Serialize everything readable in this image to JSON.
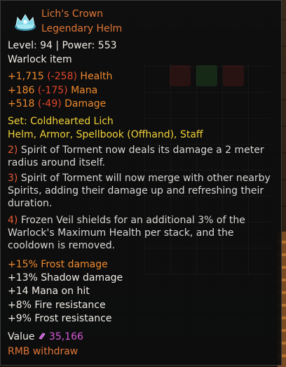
{
  "item": {
    "name": "Lich's Crown",
    "rarity_type": "Legendary Helm",
    "level_power": "Level: 94 | Power: 553",
    "class_line": "Warlock item",
    "icon": "crown-icon",
    "icon_color": "#7fd8e8"
  },
  "base_stats": [
    {
      "value": "+1,715",
      "diff": "(-258)",
      "label": "Health"
    },
    {
      "value": "+186",
      "diff": "(-175)",
      "label": "Mana"
    },
    {
      "value": "+518",
      "diff": "(-49)",
      "label": "Damage"
    }
  ],
  "set": {
    "title": "Set: Coldhearted Lich",
    "pieces": "Helm, Armor, Spellbook (Offhand), Staff",
    "bonuses": [
      {
        "num": "2)",
        "text": "Spirit of Torment now deals its damage a 2 meter radius around itself."
      },
      {
        "num": "3)",
        "text": "Spirit of Torment will now merge with other nearby Spirits, adding their damage up and refreshing their duration."
      },
      {
        "num": "4)",
        "text": "Frozen Veil shields for an additional 3% of the Warlock's Maximum Health per stack, and the cooldown is removed."
      }
    ]
  },
  "affixes": [
    {
      "text": "+15% Frost damage",
      "color": "#f08a2e"
    },
    {
      "text": "+13% Shadow damage",
      "color": "#f0ece6"
    },
    {
      "text": "+14 Mana on hit",
      "color": "#f0ece6"
    },
    {
      "text": "+8% Fire resistance",
      "color": "#f0ece6"
    },
    {
      "text": "+9% Frost resistance",
      "color": "#f0ece6"
    }
  ],
  "value": {
    "label": "Value",
    "amount": "35,166",
    "icon": "gem-icon",
    "icon_color": "#c24ad6"
  },
  "footer": {
    "withdraw": "RMB withdraw"
  },
  "colors": {
    "name_orange": "#e07636",
    "stat_red": "#e2452c",
    "set_yellow": "#f1d23a",
    "value_purple": "#d55ad8",
    "tooltip_bg": "#0c0d0e"
  }
}
